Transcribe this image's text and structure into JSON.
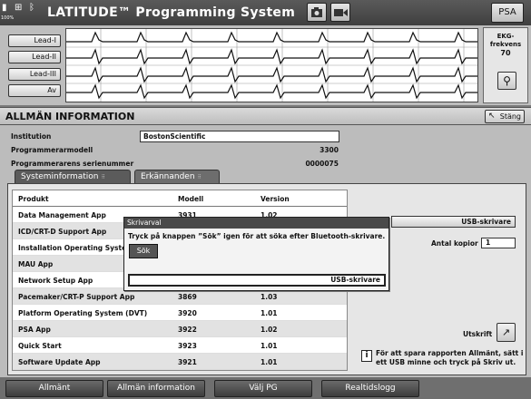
{
  "app": {
    "title": "LATITUDE™ Programming System",
    "battery_percent": "100%",
    "psa_button": "PSA",
    "icons": [
      "battery-icon",
      "network-icon",
      "bluetooth-icon",
      "camera-icon",
      "video-icon"
    ]
  },
  "ecg": {
    "leads": [
      "Lead-I",
      "Lead-II",
      "Lead-III",
      "Av"
    ],
    "rate_label_line1": "EKG-",
    "rate_label_line2": "frekvens",
    "rate_value": "70",
    "magnet_icon": "magnet-wand-icon"
  },
  "panel": {
    "title": "ALLMÄN INFORMATION",
    "close_label": "Stäng"
  },
  "info": {
    "institution_label": "Institution",
    "institution_value": "BostonScientific",
    "programmer_model_label": "Programmerarmodell",
    "programmer_model_value": "3300",
    "serial_label": "Programmerarens serienummer",
    "serial_value": "0000075"
  },
  "tabs": [
    {
      "label": "Systeminformation",
      "active": true
    },
    {
      "label": "Erkännanden",
      "active": false
    }
  ],
  "table": {
    "headers": [
      "Produkt",
      "Modell",
      "Version"
    ],
    "rows": [
      [
        "Data Management App",
        "3931",
        "1.02"
      ],
      [
        "ICD/CRT-D Support App",
        "",
        ""
      ],
      [
        "Installation Operating Syste",
        "",
        ""
      ],
      [
        "MAU App",
        "",
        ""
      ],
      [
        "Network Setup App",
        "",
        ""
      ],
      [
        "Pacemaker/CRT-P Support App",
        "3869",
        "1.03"
      ],
      [
        "Platform Operating System (DVT)",
        "3920",
        "1.01"
      ],
      [
        "PSA App",
        "3922",
        "1.02"
      ],
      [
        "Quick Start",
        "3923",
        "1.01"
      ],
      [
        "Software Update App",
        "3921",
        "1.01"
      ]
    ]
  },
  "print": {
    "printer_select": "USB-skrivare",
    "copies_label": "Antal kopior",
    "copies_value": "1",
    "print_label": "Utskrift",
    "hint": "För att spara rapporten Allmänt, sätt i ett USB minne och tryck på Skriv ut."
  },
  "dialog": {
    "title": "Skrivarval",
    "message": "Tryck på knappen ”Sök” igen för att söka efter Bluetooth-skrivare.",
    "search_button": "Sök",
    "list_item": "USB-skrivare"
  },
  "nav": [
    "Allmänt",
    "Allmän information",
    "Välj PG",
    "Realtidslogg"
  ],
  "colors": {
    "titlebar": "#4a4a4a",
    "panel_bg": "#bcbcbc",
    "nav_button": "#4d4d4d"
  }
}
